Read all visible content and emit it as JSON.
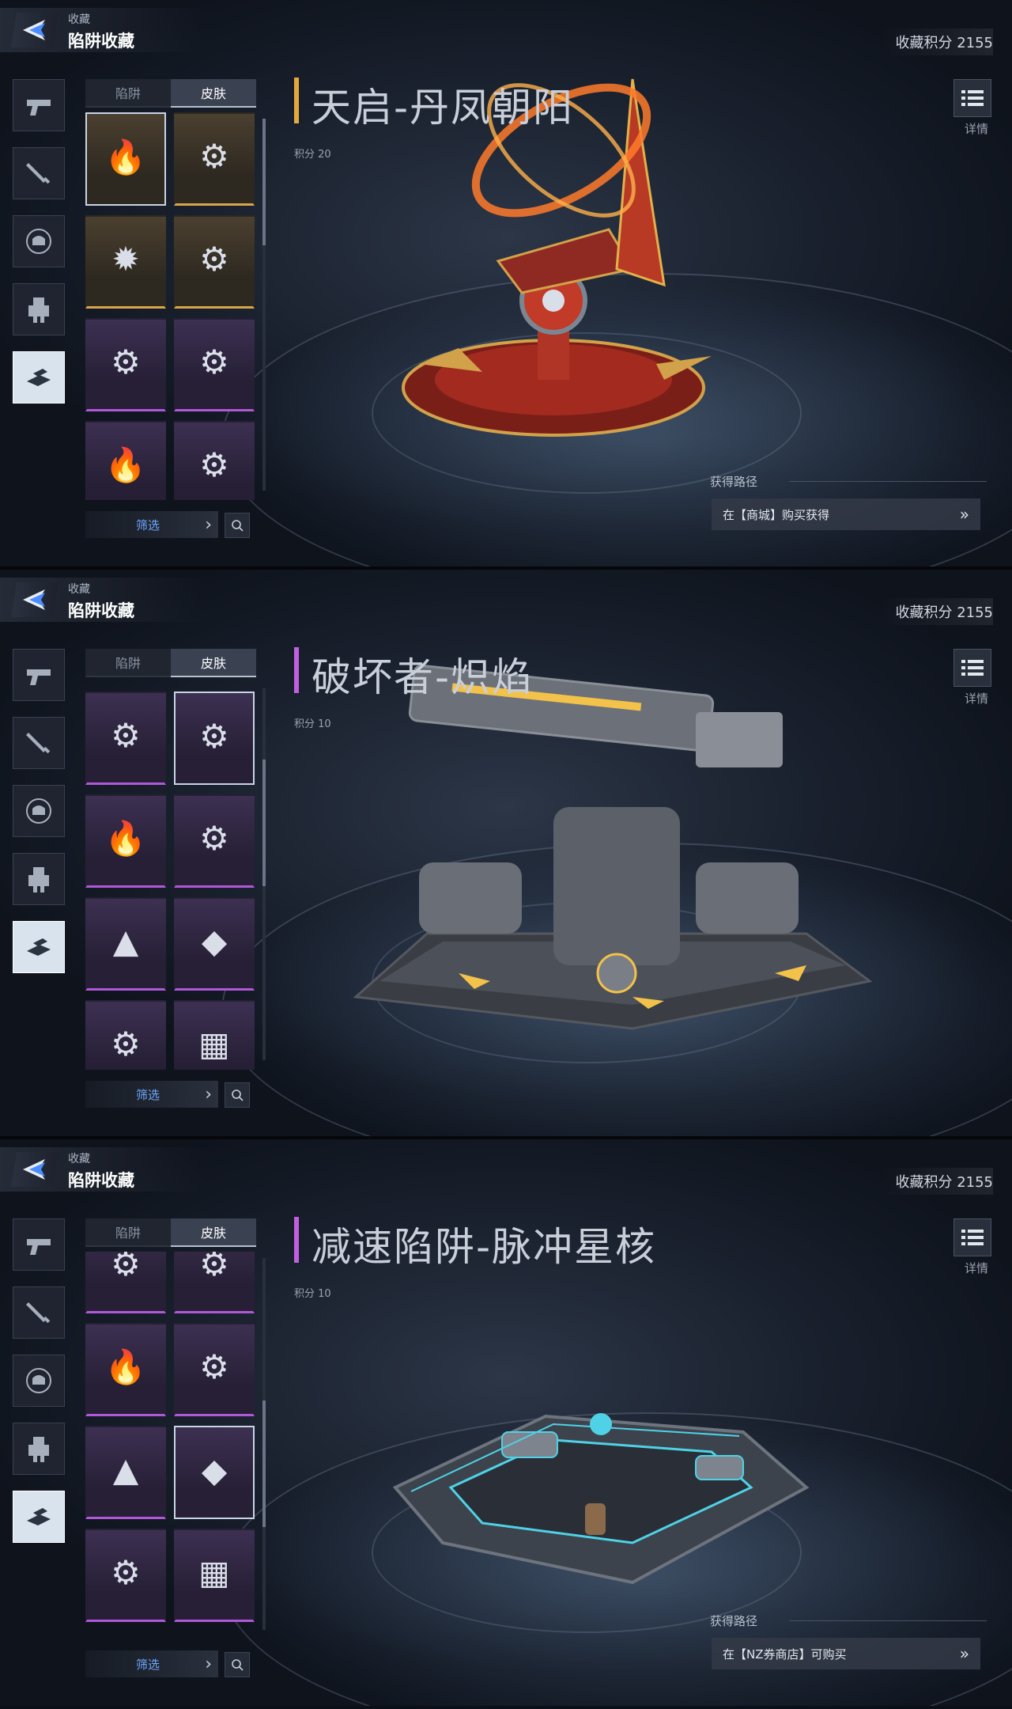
{
  "header": {
    "breadcrumb_small": "收藏",
    "breadcrumb_title": "陷阱收藏",
    "points_total": "收藏积分 2155"
  },
  "nav": {
    "items": [
      "pistol-icon",
      "knife-icon",
      "character-icon",
      "mech-icon",
      "trap-icon"
    ],
    "active_index": 4
  },
  "tabs": [
    "陷阱",
    "皮肤"
  ],
  "active_tab": "皮肤",
  "filter_label": "筛选",
  "detail_label": "详情",
  "acquire_title": "获得路径",
  "colors": {
    "gold_rarity": "#d7a64a",
    "purple_rarity": "#b157d9",
    "filter_text": "#6fa8ff"
  },
  "panels": [
    {
      "item_name": "天启-丹凤朝阳",
      "points": "积分 20",
      "accent": "#e3a93c",
      "acquire_text": "在【商城】购买获得"
    },
    {
      "item_name": "破坏者-炽焰",
      "points": "积分 10",
      "accent": "#c060e0"
    },
    {
      "item_name": "减速陷阱-脉冲星核",
      "points": "积分 10",
      "accent": "#c060e0",
      "acquire_text": "在【NZ券商店】可购买"
    }
  ]
}
